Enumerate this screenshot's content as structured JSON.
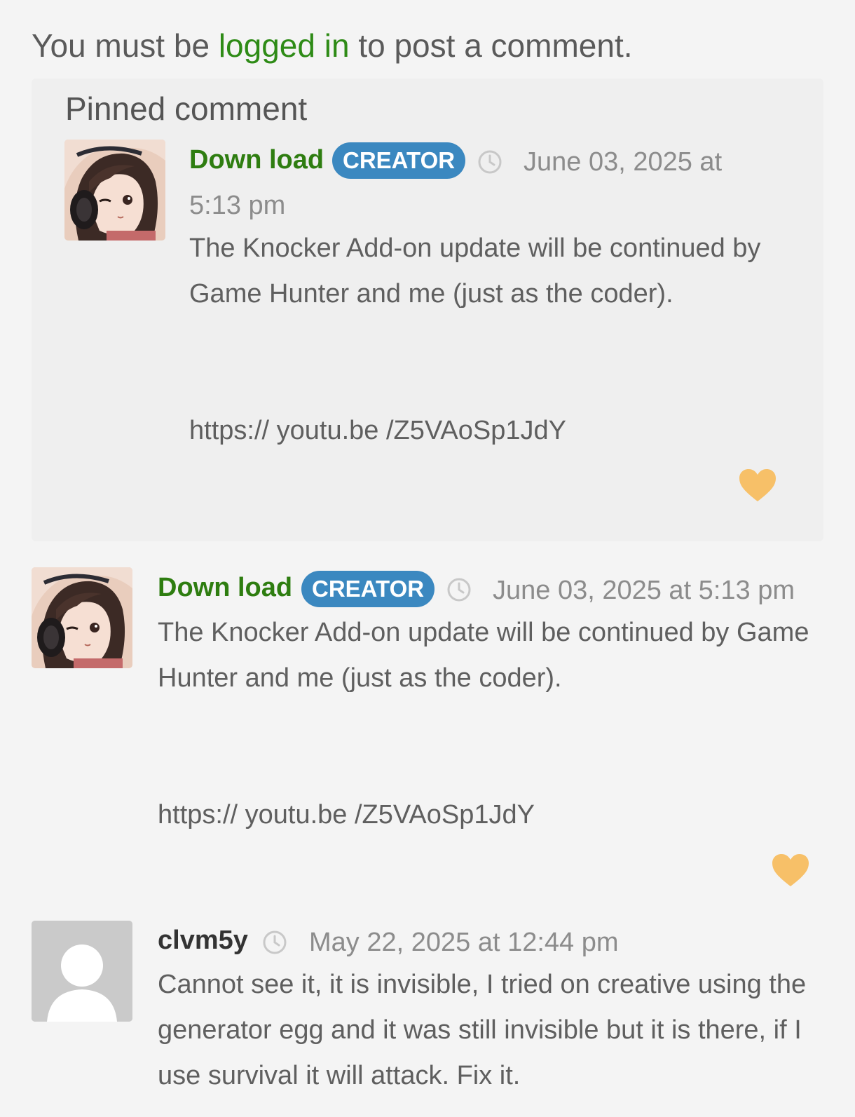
{
  "login_notice": {
    "prefix": "You must be",
    "link_label": "logged in",
    "suffix": "to post a comment."
  },
  "pinned": {
    "title": "Pinned comment",
    "comment": {
      "author": "Down load",
      "badge": "CREATOR",
      "date_line1": "June 03, 2025 at",
      "date_line2": "5:13 pm",
      "text_line1": "The Knocker Add-on update will be continued by",
      "text_line2": "Game Hunter and me (just as the coder).",
      "link": "https:// youtu.be /Z5VAoSp1JdY"
    }
  },
  "comments": [
    {
      "author": "Down load",
      "badge": "CREATOR",
      "date": "June 03, 2025 at 5:13 pm",
      "text_line1": "The Knocker Add-on update will be continued by Game",
      "text_line2": "Hunter and me (just as the coder).",
      "link": "https:// youtu.be /Z5VAoSp1JdY"
    },
    {
      "author": "clvm5y",
      "date": "May 22, 2025 at 12:44 pm",
      "text_line1": "Cannot see it, it is invisible, I tried on creative using the",
      "text_line2": "generator egg and it was still invisible but it is there, if I",
      "text_line3": "use survival it will attack. Fix it."
    }
  ],
  "colors": {
    "link_green": "#2e8b16",
    "badge_blue": "#3b88c0",
    "heart_orange": "#f7c068"
  },
  "icons": [
    "clock-icon",
    "heart-icon",
    "default-avatar-icon"
  ]
}
